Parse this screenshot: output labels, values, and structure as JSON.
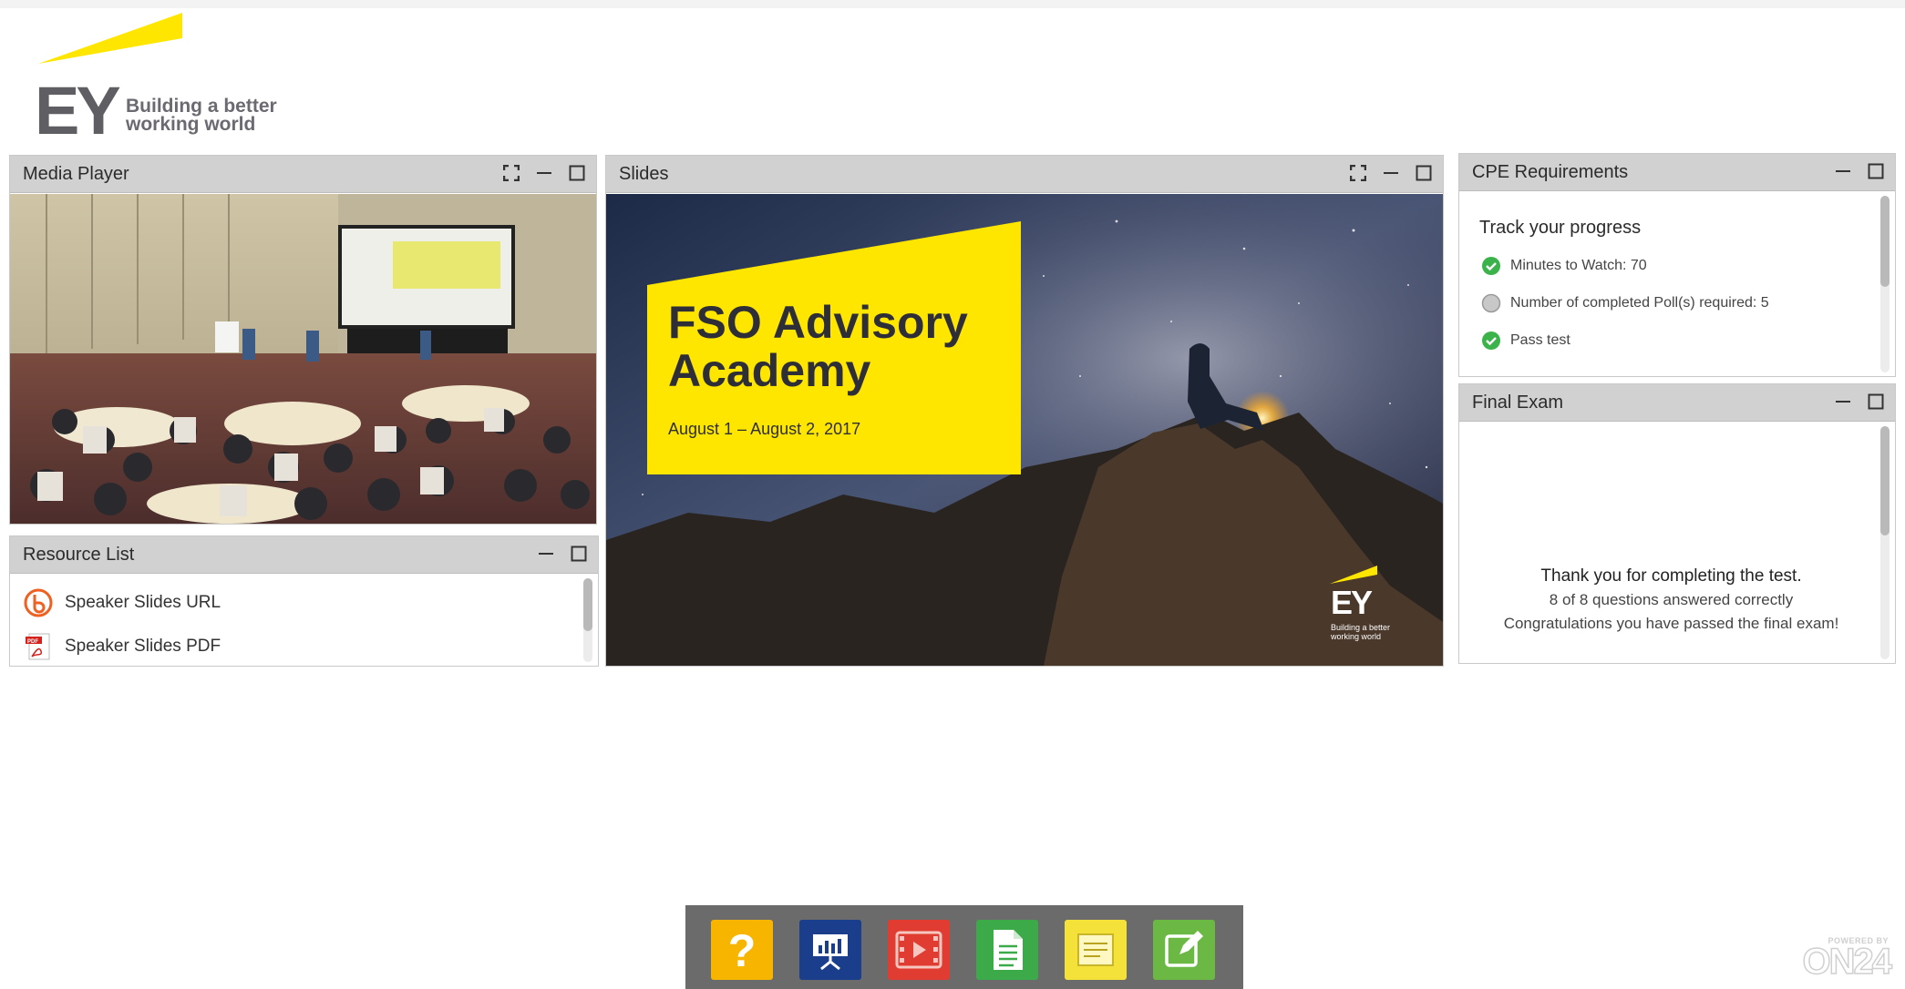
{
  "brand": {
    "logo_text": "EY",
    "tagline_line1": "Building a better",
    "tagline_line2": "working world",
    "accent": "#ffe600"
  },
  "panels": {
    "media_player": {
      "title": "Media Player"
    },
    "resource_list": {
      "title": "Resource List",
      "items": [
        {
          "label": "Speaker Slides URL",
          "icon": "bitly-link-icon"
        },
        {
          "label": "Speaker Slides PDF",
          "icon": "pdf-icon"
        }
      ]
    },
    "slides": {
      "title": "Slides",
      "slide_title_line1": "FSO Advisory",
      "slide_title_line2": "Academy",
      "slide_date": "August 1 – August 2, 2017",
      "slide_logo": "EY",
      "slide_tagline_line1": "Building a better",
      "slide_tagline_line2": "working world"
    },
    "cpe": {
      "title": "CPE Requirements",
      "heading": "Track your progress",
      "items": [
        {
          "label": "Minutes to Watch: 70",
          "status": "complete"
        },
        {
          "label": "Number of completed Poll(s) required: 5",
          "status": "incomplete"
        },
        {
          "label": "Pass test",
          "status": "complete"
        }
      ]
    },
    "final_exam": {
      "title": "Final Exam",
      "line1": "Thank you for completing the test.",
      "line2": "8 of 8 questions answered correctly",
      "line3": "Congratulations you have passed the final exam!"
    }
  },
  "dock": {
    "buttons": [
      {
        "name": "help",
        "icon": "question-icon",
        "color": "#f7b500"
      },
      {
        "name": "slides",
        "icon": "presentation-icon",
        "color": "#1a3e8c"
      },
      {
        "name": "media",
        "icon": "video-icon",
        "color": "#e03c31"
      },
      {
        "name": "resources",
        "icon": "document-icon",
        "color": "#3daa4a"
      },
      {
        "name": "notes",
        "icon": "notepad-icon",
        "color": "#f4e23a"
      },
      {
        "name": "survey",
        "icon": "edit-icon",
        "color": "#6bb844"
      }
    ]
  },
  "footer": {
    "powered_by": "POWERED BY",
    "brand": "ON24"
  }
}
